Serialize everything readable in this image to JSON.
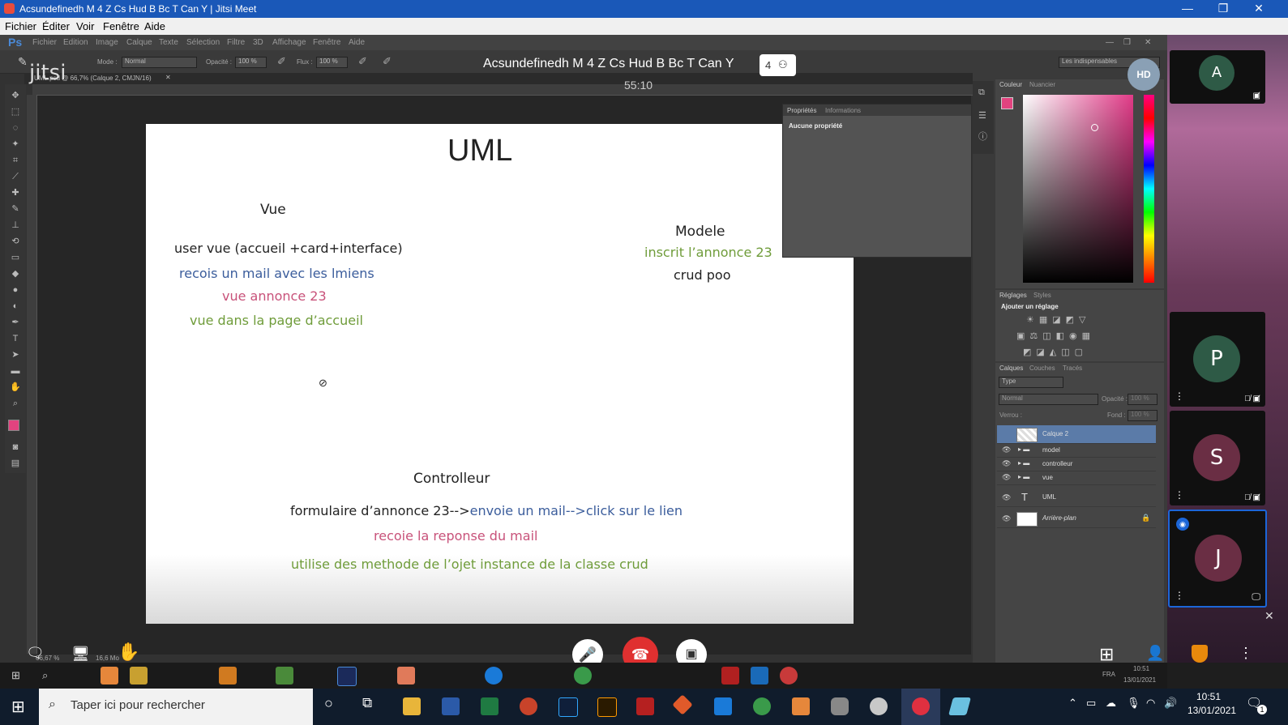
{
  "window": {
    "title": "Acsundefinedh M 4 Z Cs Hud B Bc T Can Y | Jitsi Meet"
  },
  "app_menu": [
    "Fichier",
    "Éditer",
    "Voir",
    "Fenêtre",
    "Aide"
  ],
  "ps": {
    "logo": "Ps",
    "menu": [
      "Fichier",
      "Edition",
      "Image",
      "Calque",
      "Texte",
      "Sélection",
      "Filtre",
      "3D",
      "Affichage",
      "Fenêtre",
      "Aide"
    ],
    "options": {
      "mode_label": "Mode :",
      "mode_value": "Normal",
      "opacity_label": "Opacité :",
      "opacity_value": "100 %",
      "flux_label": "Flux :",
      "flux_value": "100 %",
      "workspace": "Les indispensables"
    },
    "tab": "UML.psd @ 66,7% (Calque 2, CMJN/16)",
    "zoom_status": "66,67 %",
    "doc_status": "16,6 Mo",
    "properties": {
      "tabs": [
        "Propriétés",
        "Informations"
      ],
      "empty": "Aucune propriété"
    },
    "color_panel": {
      "tabs": [
        "Couleur",
        "Nuancier"
      ]
    },
    "adjust_panel": {
      "tabs": [
        "Réglages",
        "Styles"
      ],
      "add_label": "Ajouter un réglage"
    },
    "layers_panel": {
      "tabs": [
        "Calques",
        "Couches",
        "Tracés"
      ],
      "filter": "Type",
      "blend": "Normal",
      "opacity_label": "Opacité :",
      "opacity_value": "100 %",
      "lock_label": "Verrou :",
      "fill_label": "Fond :",
      "fill_value": "100 %",
      "layers": [
        "Calque 2",
        "model",
        "controlleur",
        "vue",
        "UML",
        "Arrière-plan"
      ]
    }
  },
  "slide": {
    "title": "UML",
    "vue": {
      "heading": "Vue",
      "line1": "user vue (accueil +card+interface)",
      "line2": "recois un mail avec les lmiens",
      "line3": "vue annonce 23",
      "line4": "vue dans la page d’accueil"
    },
    "modele": {
      "heading": "Modele",
      "line1": "inscrit l’annonce 23",
      "line2": "crud poo"
    },
    "controlleur": {
      "heading": "Controlleur",
      "line1_a": "formulaire d’annonce 23-->",
      "line1_b": "envoie un mail-->click sur le lien",
      "line2": "recoie la reponse du mail",
      "line3": "utilise des methode de l’ojet instance de la classe crud"
    }
  },
  "jitsi": {
    "logo": "jitsi",
    "meeting_title": "Acsundefinedh M 4 Z Cs Hud B Bc T Can Y",
    "participant_count": "4",
    "timer": "55:10",
    "quality": "HD",
    "participants": [
      {
        "initial": "A",
        "color": "#2e5a46"
      },
      {
        "initial": "P",
        "color": "#2e5a46"
      },
      {
        "initial": "S",
        "color": "#6a2e44"
      },
      {
        "initial": "J",
        "color": "#6a2e44"
      }
    ]
  },
  "ps_taskbar": {
    "lang": "FRA",
    "time": "10:51",
    "date": "13/01/2021"
  },
  "taskbar": {
    "search_placeholder": "Taper ici pour rechercher",
    "lang": "FRA",
    "time": "10:51",
    "date": "13/01/2021",
    "notifications": "1"
  },
  "colors": {
    "accent": "#1a58b8",
    "hangup": "#e03030",
    "dominant_speaker": "#1c66d8"
  }
}
